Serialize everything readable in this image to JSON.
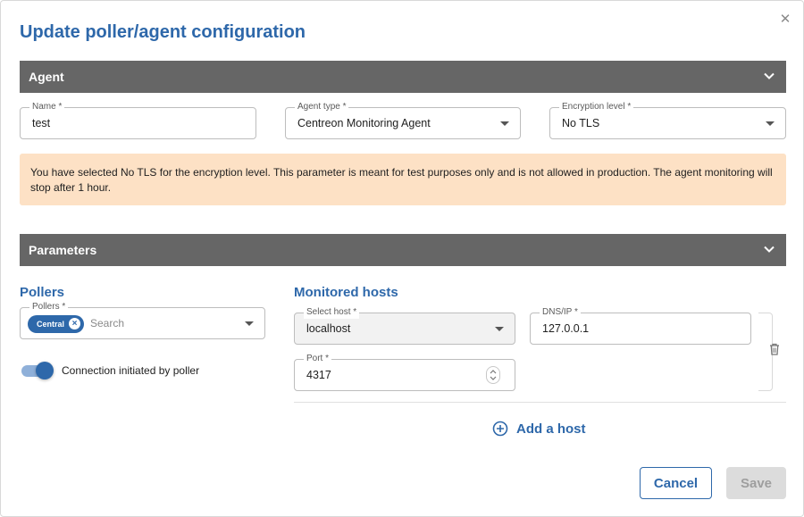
{
  "dialog": {
    "title": "Update poller/agent configuration",
    "close_icon": "close-icon"
  },
  "agent_section": {
    "header": "Agent",
    "name_field": {
      "label": "Name *",
      "value": "test"
    },
    "agent_type_field": {
      "label": "Agent type *",
      "value": "Centreon Monitoring Agent"
    },
    "encryption_field": {
      "label": "Encryption level *",
      "value": "No TLS"
    },
    "warning": "You have selected No TLS for the encryption level. This parameter is meant for test purposes only and is not allowed in production. The agent monitoring will stop after 1 hour."
  },
  "parameters_section": {
    "header": "Parameters",
    "pollers": {
      "title": "Pollers",
      "field_label": "Pollers *",
      "chips": [
        "Central"
      ],
      "search_placeholder": "Search"
    },
    "toggle": {
      "label": "Connection initiated by poller",
      "on": true
    },
    "monitored_hosts": {
      "title": "Monitored hosts",
      "select_host": {
        "label": "Select host *",
        "value": "localhost"
      },
      "dns_ip": {
        "label": "DNS/IP *",
        "value": "127.0.0.1"
      },
      "port": {
        "label": "Port *",
        "value": "4317"
      },
      "add_host_label": "Add a host"
    }
  },
  "actions": {
    "cancel_label": "Cancel",
    "save_label": "Save"
  },
  "colors": {
    "primary": "#2e68aa",
    "section_header": "#666666",
    "warning_bg": "#fde1c5"
  }
}
